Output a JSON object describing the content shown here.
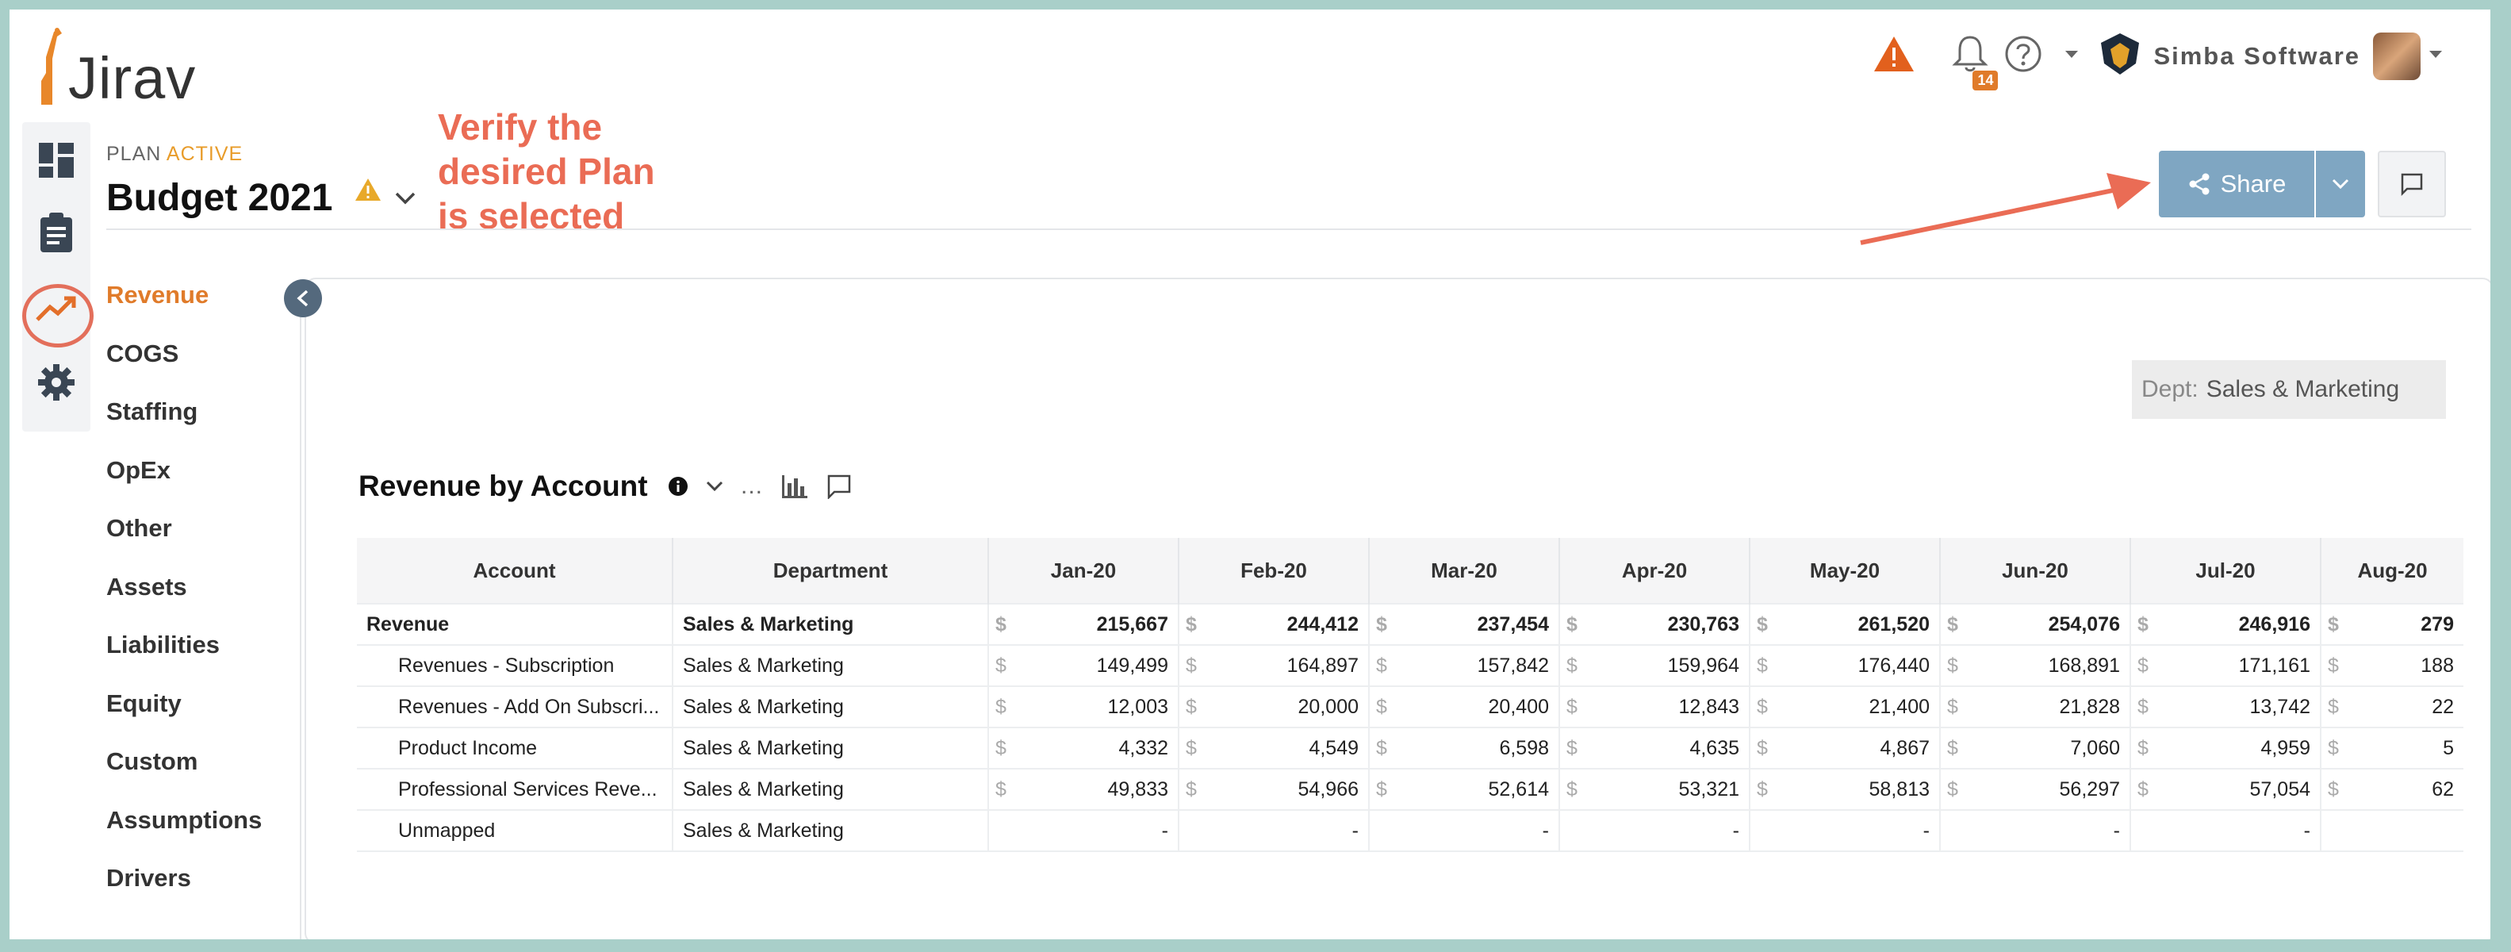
{
  "app": {
    "name": "Jirav"
  },
  "header": {
    "notification_count": "14",
    "company": "Simba Software"
  },
  "plan": {
    "label_prefix": "PLAN",
    "label_status": "ACTIVE",
    "name": "Budget 2021"
  },
  "annotation": {
    "line1": "Verify the",
    "line2": "desired Plan",
    "line3": "is selected",
    "color": "#ea6c55"
  },
  "actions": {
    "share_label": "Share"
  },
  "sidebar": {
    "items": [
      {
        "label": "Revenue",
        "active": true
      },
      {
        "label": "COGS"
      },
      {
        "label": "Staffing"
      },
      {
        "label": "OpEx"
      },
      {
        "label": "Other"
      },
      {
        "label": "Assets"
      },
      {
        "label": "Liabilities"
      },
      {
        "label": "Equity"
      },
      {
        "label": "Custom"
      },
      {
        "label": "Assumptions"
      },
      {
        "label": "Drivers"
      }
    ]
  },
  "dept_filter": {
    "key": "Dept:",
    "value": "Sales & Marketing"
  },
  "section": {
    "title": "Revenue by Account",
    "more": "..."
  },
  "table": {
    "headers": [
      "Account",
      "Department",
      "Jan-20",
      "Feb-20",
      "Mar-20",
      "Apr-20",
      "May-20",
      "Jun-20",
      "Jul-20",
      "Aug-20"
    ],
    "currency": "$",
    "rows": [
      {
        "account": "Revenue",
        "department": "Sales & Marketing",
        "values": [
          "215,667",
          "244,412",
          "237,454",
          "230,763",
          "261,520",
          "254,076",
          "246,916",
          "279"
        ]
      },
      {
        "account": "Revenues - Subscription",
        "department": "Sales & Marketing",
        "values": [
          "149,499",
          "164,897",
          "157,842",
          "159,964",
          "176,440",
          "168,891",
          "171,161",
          "188"
        ]
      },
      {
        "account": "Revenues - Add On Subscri...",
        "department": "Sales & Marketing",
        "values": [
          "12,003",
          "20,000",
          "20,400",
          "12,843",
          "21,400",
          "21,828",
          "13,742",
          "22"
        ]
      },
      {
        "account": "Product Income",
        "department": "Sales & Marketing",
        "values": [
          "4,332",
          "4,549",
          "6,598",
          "4,635",
          "4,867",
          "7,060",
          "4,959",
          "5"
        ]
      },
      {
        "account": "Professional Services Reve...",
        "department": "Sales & Marketing",
        "values": [
          "49,833",
          "54,966",
          "52,614",
          "53,321",
          "58,813",
          "56,297",
          "57,054",
          "62"
        ]
      },
      {
        "account": "Unmapped",
        "department": "Sales & Marketing",
        "values": [
          "-",
          "-",
          "-",
          "-",
          "-",
          "-",
          "-",
          ""
        ]
      }
    ]
  },
  "colors": {
    "accent_orange": "#e07b2a",
    "share_blue": "#7fa6c2",
    "annotation_red": "#ea6c55"
  }
}
